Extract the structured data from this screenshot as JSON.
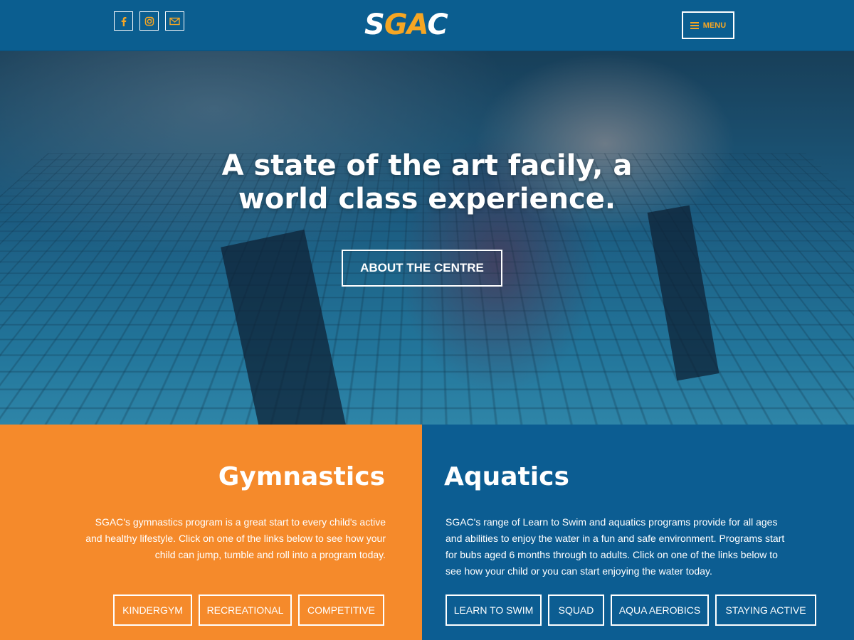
{
  "header": {
    "social": [
      {
        "icon": "facebook-icon",
        "label": "Facebook"
      },
      {
        "icon": "instagram-icon",
        "label": "Instagram"
      },
      {
        "icon": "email-icon",
        "label": "Email"
      }
    ],
    "logo_text": "SGAC",
    "menu_label": "MENU"
  },
  "hero": {
    "title_line1": "A state of the art facily, a",
    "title_line2": "world class experience.",
    "button_label": "ABOUT THE CENTRE"
  },
  "gymnastics": {
    "title": "Gymnastics",
    "text": "SGAC's gymnastics program is a great start to every child's active and healthy lifestyle. Click on one of the links below to see how your child can jump, tumble and roll into a program today.",
    "buttons": [
      "KINDERGYM",
      "RECREATIONAL",
      "COMPETITIVE"
    ]
  },
  "aquatics": {
    "title": "Aquatics",
    "text": "SGAC's range of Learn to Swim and aquatics programs provide for all ages and abilities to enjoy the water in a fun and safe environment. Programs start for bubs aged 6 months through to adults. Click on one of the links below to see how your child or you can start enjoying the water today.",
    "buttons": [
      "LEARN TO SWIM",
      "SQUAD",
      "AQUA AEROBICS",
      "STAYING ACTIVE"
    ]
  },
  "colors": {
    "brand_blue": "#0b5e90",
    "brand_orange": "#f58a2b",
    "logo_orange": "#f6a623"
  }
}
